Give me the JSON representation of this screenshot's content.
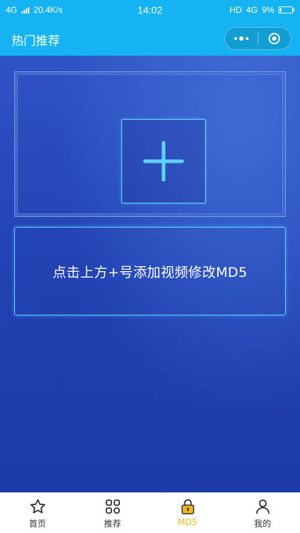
{
  "status_bar": {
    "network": "4G",
    "speed": "20.4K/s",
    "time": "14:02",
    "hd": "HD",
    "network_right": "4G",
    "battery": "9%"
  },
  "header": {
    "title": "热门推荐"
  },
  "main": {
    "hint": "点击上方+号添加视频修改MD5"
  },
  "tabs": [
    {
      "label": "首页",
      "icon": "star-icon"
    },
    {
      "label": "推荐",
      "icon": "grid-icon"
    },
    {
      "label": "MD5",
      "icon": "lock-icon",
      "active": true
    },
    {
      "label": "我的",
      "icon": "user-icon"
    }
  ],
  "colors": {
    "header": "#15b3f2",
    "accent_active": "#f2b818",
    "frame_border": "#5fd2ff"
  }
}
